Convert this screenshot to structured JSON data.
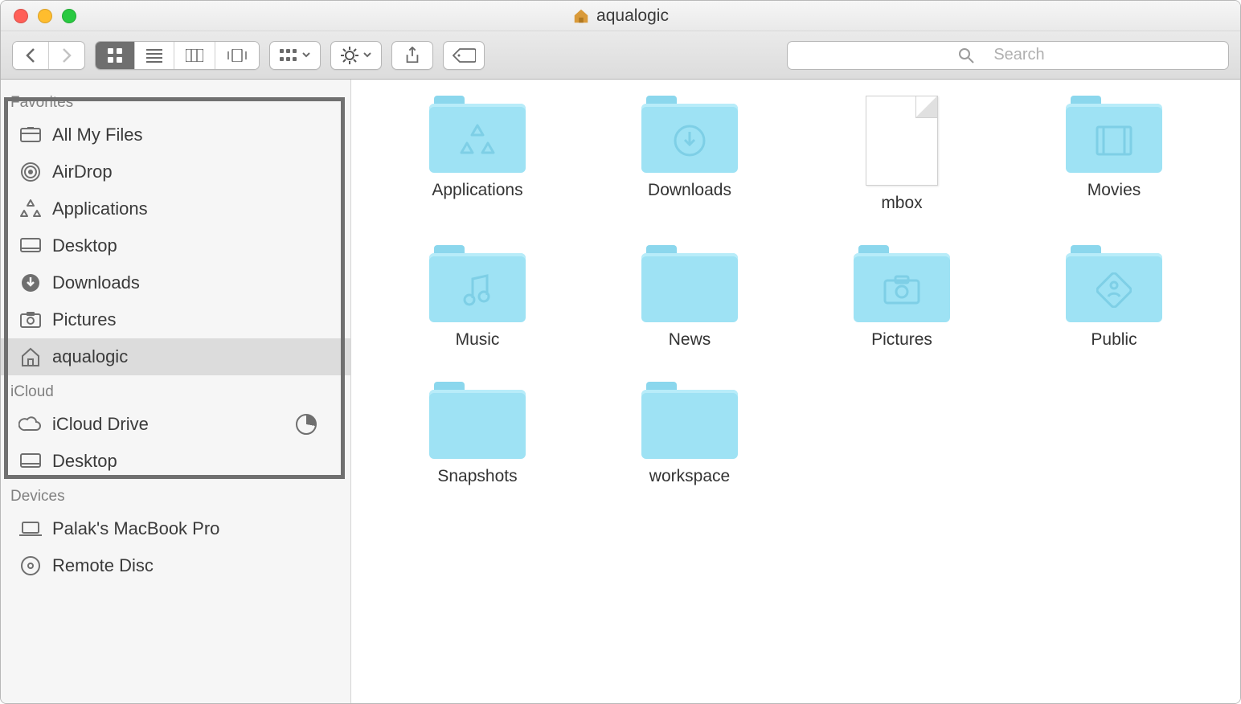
{
  "title": "aqualogic",
  "search": {
    "placeholder": "Search"
  },
  "sidebar": {
    "sections": [
      {
        "label": "Favorites",
        "items": [
          {
            "label": "All My Files",
            "icon": "all-my-files"
          },
          {
            "label": "AirDrop",
            "icon": "airdrop"
          },
          {
            "label": "Applications",
            "icon": "applications"
          },
          {
            "label": "Desktop",
            "icon": "desktop"
          },
          {
            "label": "Downloads",
            "icon": "downloads"
          },
          {
            "label": "Pictures",
            "icon": "pictures"
          },
          {
            "label": "aqualogic",
            "icon": "home",
            "selected": true
          }
        ]
      },
      {
        "label": "iCloud",
        "items": [
          {
            "label": "iCloud Drive",
            "icon": "cloud",
            "showPie": true
          },
          {
            "label": "Desktop",
            "icon": "desktop"
          }
        ]
      },
      {
        "label": "Devices",
        "items": [
          {
            "label": "Palak's MacBook Pro",
            "icon": "laptop"
          },
          {
            "label": "Remote Disc",
            "icon": "disc"
          }
        ]
      }
    ]
  },
  "grid": [
    {
      "label": "Applications",
      "type": "folder",
      "glyph": "apps"
    },
    {
      "label": "Downloads",
      "type": "folder",
      "glyph": "download"
    },
    {
      "label": "mbox",
      "type": "file"
    },
    {
      "label": "Movies",
      "type": "folder",
      "glyph": "movies"
    },
    {
      "label": "Music",
      "type": "folder",
      "glyph": "music"
    },
    {
      "label": "News",
      "type": "folder",
      "glyph": ""
    },
    {
      "label": "Pictures",
      "type": "folder",
      "glyph": "pictures"
    },
    {
      "label": "Public",
      "type": "folder",
      "glyph": "public"
    },
    {
      "label": "Snapshots",
      "type": "folder",
      "glyph": ""
    },
    {
      "label": "workspace",
      "type": "folder",
      "glyph": ""
    }
  ]
}
